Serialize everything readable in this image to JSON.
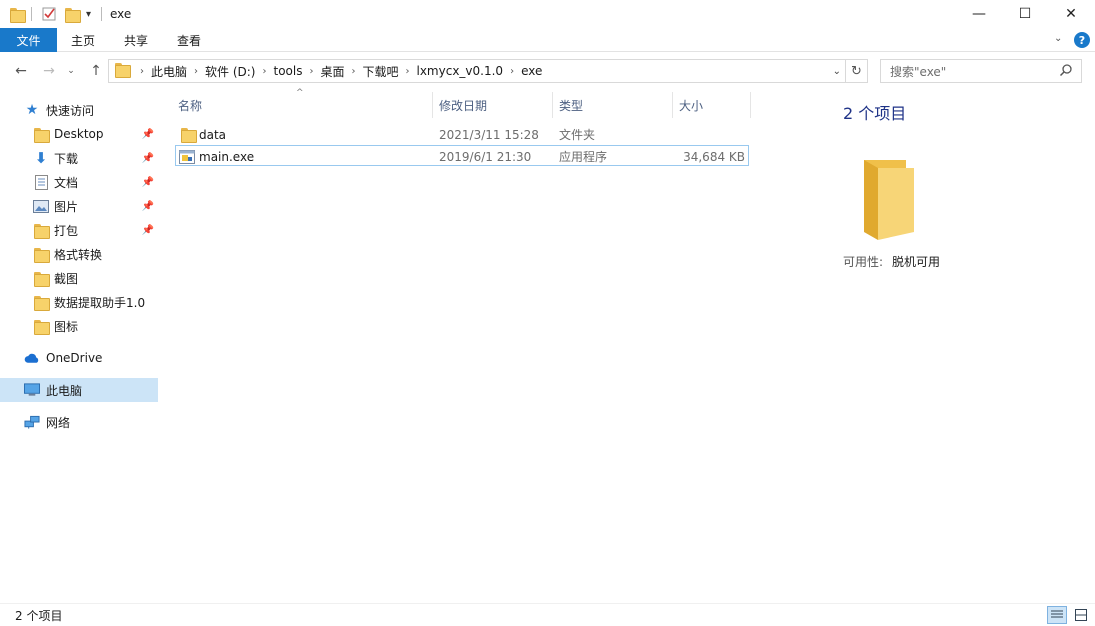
{
  "window": {
    "title": "exe",
    "minimize": "—",
    "maximize": "☐",
    "close": "✕"
  },
  "ribbon": {
    "tabs": [
      {
        "label": "文件"
      },
      {
        "label": "主页"
      },
      {
        "label": "共享"
      },
      {
        "label": "查看"
      }
    ],
    "help": "?"
  },
  "address": {
    "crumbs": [
      {
        "label": "此电脑"
      },
      {
        "label": "软件 (D:)"
      },
      {
        "label": "tools"
      },
      {
        "label": "桌面"
      },
      {
        "label": "下载吧"
      },
      {
        "label": "lxmycx_v0.1.0"
      },
      {
        "label": "exe"
      }
    ]
  },
  "search": {
    "placeholder": "搜索\"exe\""
  },
  "nav": {
    "quick_access": "快速访问",
    "items": [
      {
        "label": "Desktop",
        "icon": "folder-icon",
        "pinned": true
      },
      {
        "label": "下载",
        "icon": "download-arrow-icon",
        "pinned": true
      },
      {
        "label": "文档",
        "icon": "document-icon",
        "pinned": true
      },
      {
        "label": "图片",
        "icon": "pictures-icon",
        "pinned": true
      },
      {
        "label": "打包",
        "icon": "folder-icon",
        "pinned": true
      },
      {
        "label": "格式转换",
        "icon": "folder-icon",
        "pinned": false
      },
      {
        "label": "截图",
        "icon": "folder-icon",
        "pinned": false
      },
      {
        "label": "数据提取助手1.0",
        "icon": "folder-icon",
        "pinned": false
      },
      {
        "label": "图标",
        "icon": "folder-icon",
        "pinned": false
      }
    ],
    "onedrive": "OneDrive",
    "thispc": "此电脑",
    "network": "网络"
  },
  "columns": {
    "name": "名称",
    "modified": "修改日期",
    "type": "类型",
    "size": "大小"
  },
  "files": [
    {
      "name": "data",
      "modified": "2021/3/11 15:28",
      "type": "文件夹",
      "size": "",
      "icon": "folder-icon"
    },
    {
      "name": "main.exe",
      "modified": "2019/6/1 21:30",
      "type": "应用程序",
      "size": "34,684 KB",
      "icon": "exe-icon"
    }
  ],
  "preview": {
    "title": "2 个项目",
    "availability_label": "可用性:",
    "availability_value": "脱机可用"
  },
  "status": {
    "count": "2 个项目"
  },
  "colors": {
    "accent": "#1979ca",
    "selected": "#cce4f7",
    "header_text": "#4d6082",
    "folder": "#f7d26a"
  }
}
